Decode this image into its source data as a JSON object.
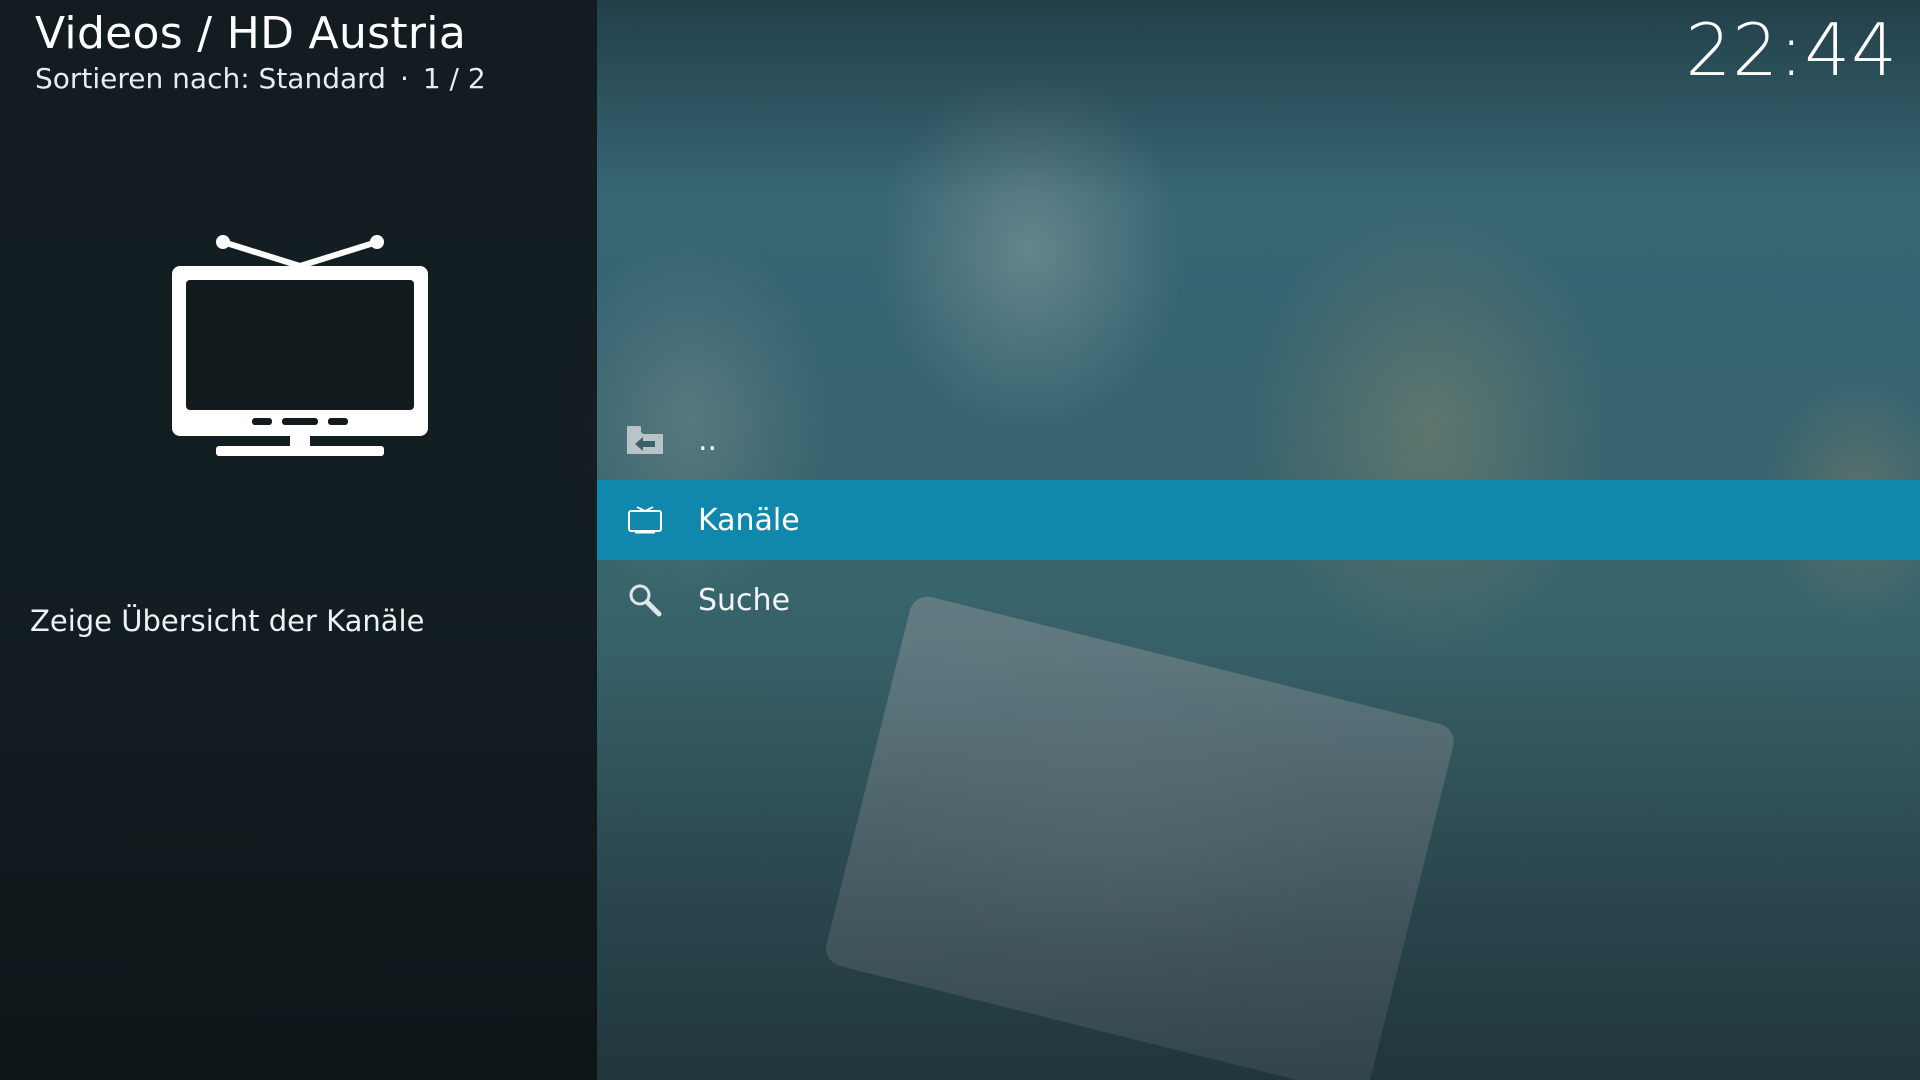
{
  "header": {
    "title": "Videos / HD Austria",
    "sort_label": "Sortieren nach: Standard",
    "separator": "·",
    "page": "1 / 2"
  },
  "clock": "22:44",
  "big_icon": "tv-icon",
  "description": "Zeige Übersicht der Kanäle",
  "list": {
    "items": [
      {
        "label": "..",
        "icon": "folder-back-icon",
        "selected": false
      },
      {
        "label": "Kanäle",
        "icon": "tv-icon",
        "selected": true
      },
      {
        "label": "Suche",
        "icon": "search-icon",
        "selected": false
      }
    ]
  },
  "colors": {
    "accent": "#1087ad",
    "panel": "#121a1e",
    "text": "#ffffff"
  }
}
